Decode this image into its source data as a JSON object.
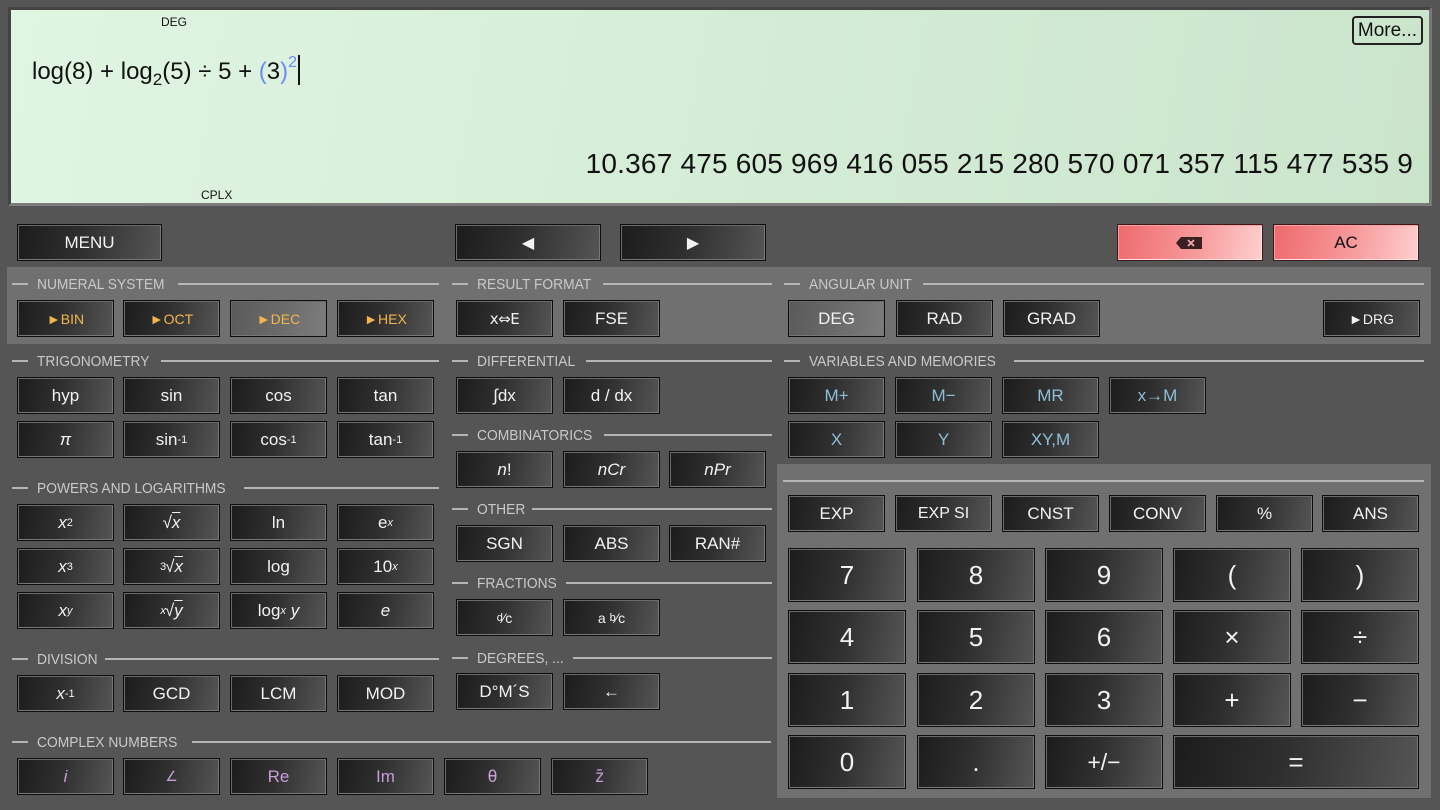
{
  "display": {
    "indicator_angle": "DEG",
    "indicator_mode": "CPLX",
    "more_button": "More...",
    "expression": {
      "log_fn": "log",
      "arg1": "(8)",
      "op1": " + ",
      "log2_fn": "log",
      "log2_base": "2",
      "arg2": "(5)",
      "op2": " ÷ 5 + ",
      "paren_open": "(",
      "arg3": "3",
      "paren_close": ")",
      "exponent": "2"
    },
    "result": "10.367 475 605 969 416 055 215 280 570 071 357 115 477 535 9"
  },
  "toolbar": {
    "menu": "MENU",
    "cursor_left": "◀",
    "cursor_right": "▶",
    "backspace_icon": "backspace-icon",
    "all_clear": "AC"
  },
  "sections": {
    "numeral_system": {
      "title": "NUMERAL SYSTEM",
      "buttons": [
        "►BIN",
        "►OCT",
        "►DEC",
        "►HEX"
      ],
      "selected": "►DEC"
    },
    "result_format": {
      "title": "RESULT FORMAT",
      "buttons": [
        "x⇔E",
        "FSE"
      ]
    },
    "angular_unit": {
      "title": "ANGULAR UNIT",
      "buttons": [
        "DEG",
        "RAD",
        "GRAD"
      ],
      "selected": "DEG",
      "convert": "►DRG"
    },
    "trigonometry": {
      "title": "TRIGONOMETRY",
      "row1": [
        "hyp",
        "sin",
        "cos",
        "tan"
      ],
      "row2": [
        "π",
        "sin",
        "cos",
        "tan"
      ],
      "inverse_sup": "-1"
    },
    "powers_logs": {
      "title": "POWERS AND LOGARITHMS",
      "x": "x",
      "sq_sup": "2",
      "cube_sup": "3",
      "y_sup": "y",
      "sqrt": "√",
      "cbrt_pre": "3",
      "xrt_pre": "x",
      "y": "y",
      "ln": "ln",
      "log": "log",
      "log_sub": "x",
      "e": "e",
      "ten": "10",
      "x_sup": "x"
    },
    "division": {
      "title": "DIVISION",
      "recip_base": "x",
      "recip_sup": "-1",
      "buttons": [
        "GCD",
        "LCM",
        "MOD"
      ]
    },
    "complex": {
      "title": "COMPLEX NUMBERS",
      "buttons": [
        "i",
        "∠",
        "Re",
        "Im",
        "θ",
        "z̄"
      ]
    },
    "differential": {
      "title": "DIFFERENTIAL",
      "buttons": [
        "∫dx",
        "d / dx"
      ]
    },
    "combinatorics": {
      "title": "COMBINATORICS",
      "n": "n",
      "fact": "!",
      "ncr": "Cr",
      "npr": "Pr"
    },
    "other": {
      "title": "OTHER",
      "buttons": [
        "SGN",
        "ABS",
        "RAN#"
      ]
    },
    "fractions": {
      "title": "FRACTIONS",
      "d": "d",
      "c": "⁄c",
      "a": "a ",
      "b": "b"
    },
    "degrees": {
      "title": "DEGREES, ...",
      "buttons": [
        "D°M´S",
        "←"
      ]
    },
    "variables": {
      "title": "VARIABLES AND MEMORIES",
      "row1": [
        "M+",
        "M−",
        "MR",
        "x→M"
      ],
      "row2": [
        "X",
        "Y",
        "XY,M"
      ]
    },
    "functions_row": [
      "EXP",
      "EXP SI",
      "CNST",
      "CONV",
      "%",
      "ANS"
    ]
  },
  "keypad": {
    "rows": [
      [
        "7",
        "8",
        "9",
        "(",
        ")"
      ],
      [
        "4",
        "5",
        "6",
        "×",
        "÷"
      ],
      [
        "1",
        "2",
        "3",
        "+",
        "−"
      ],
      [
        "0",
        ".",
        "+/−",
        "="
      ]
    ]
  }
}
